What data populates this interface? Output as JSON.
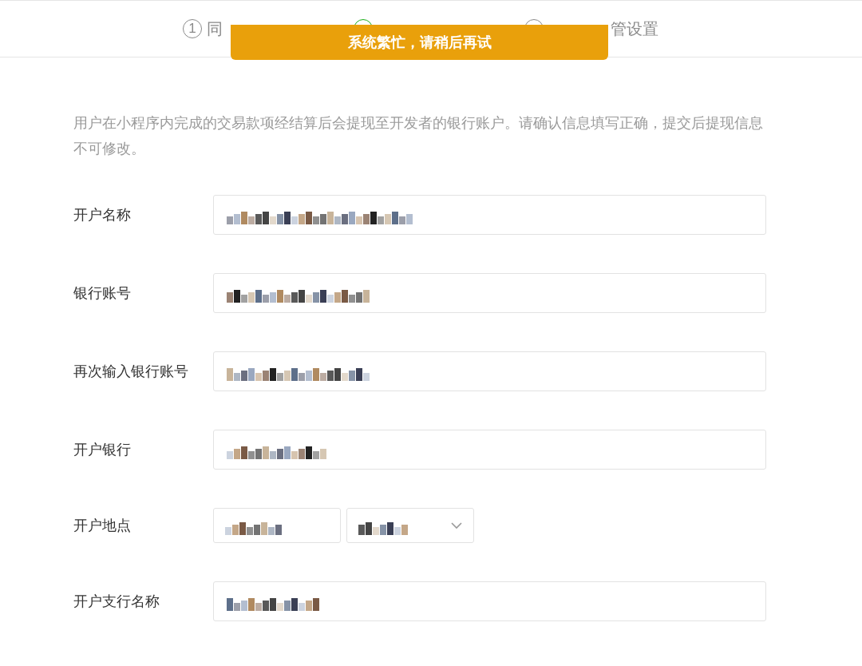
{
  "steps": [
    {
      "number": "1",
      "label": "同",
      "selected": false
    },
    {
      "selected": true
    },
    {
      "label": "管设置",
      "selected": false
    }
  ],
  "toast": "系统繁忙，请稍后再试",
  "description": "用户在小程序内完成的交易款项经结算后会提现至开发者的银行账户。请确认信息填写正确，提交后提现信息不可修改。",
  "fields": [
    {
      "label": "开户名称",
      "kind": "input"
    },
    {
      "label": "银行账号",
      "kind": "input"
    },
    {
      "label": "再次输入银行账号",
      "kind": "input"
    },
    {
      "label": "开户银行",
      "kind": "input"
    },
    {
      "label": "开户地点",
      "kind": "selects"
    },
    {
      "label": "开户支行名称",
      "kind": "input"
    }
  ]
}
